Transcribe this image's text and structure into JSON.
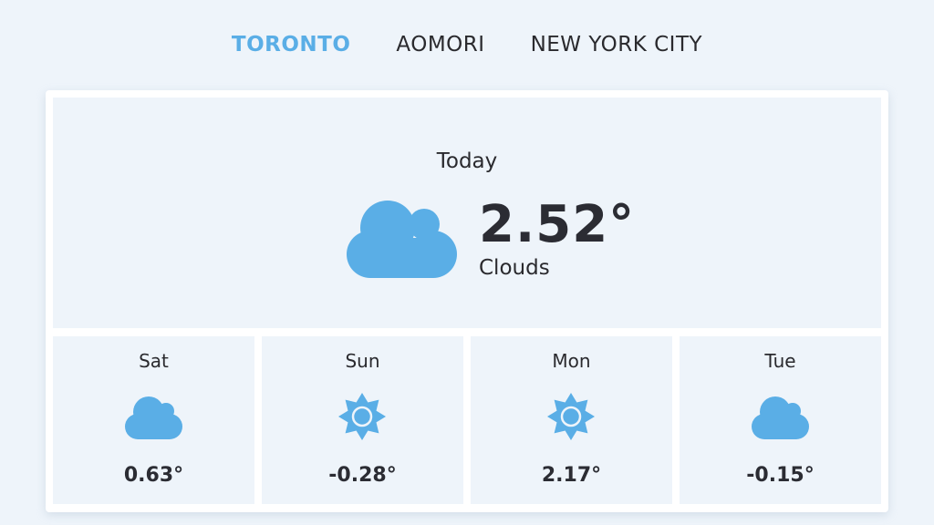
{
  "cities": [
    {
      "label": "TORONTO",
      "active": true
    },
    {
      "label": "AOMORI",
      "active": false
    },
    {
      "label": "NEW YORK CITY",
      "active": false
    }
  ],
  "today": {
    "label": "Today",
    "icon": "cloud-icon",
    "temperature": "2.52°",
    "condition": "Clouds"
  },
  "forecast": [
    {
      "day": "Sat",
      "icon": "cloud-icon",
      "temperature": "0.63°"
    },
    {
      "day": "Sun",
      "icon": "sun-icon",
      "temperature": "-0.28°"
    },
    {
      "day": "Mon",
      "icon": "sun-icon",
      "temperature": "2.17°"
    },
    {
      "day": "Tue",
      "icon": "cloud-icon",
      "temperature": "-0.15°"
    }
  ],
  "colors": {
    "accent": "#5aaee6",
    "text": "#2a2a2e",
    "panel": "#eef4fa",
    "card": "#ffffff"
  }
}
